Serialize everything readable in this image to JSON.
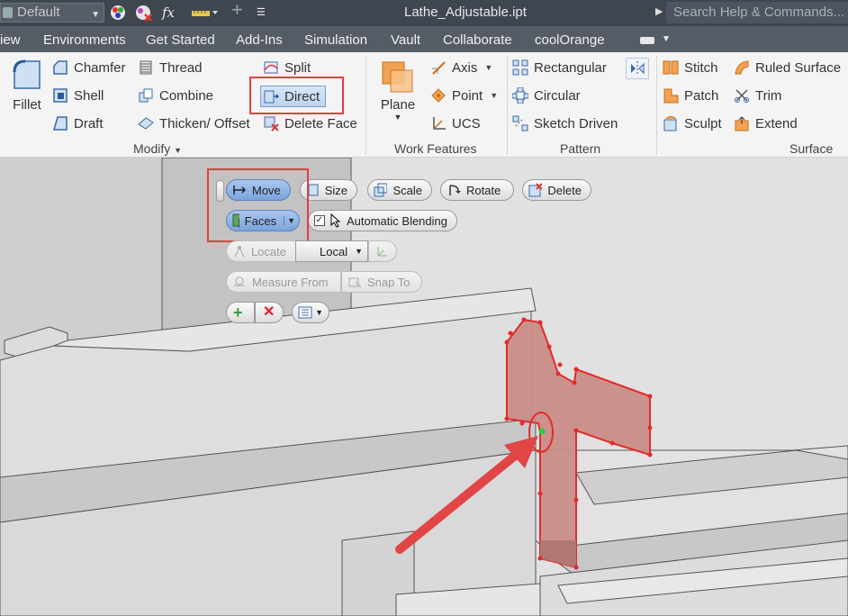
{
  "titlebar": {
    "style_combo": "Default",
    "document_title": "Lathe_Adjustable.ipt",
    "help_search_placeholder": "Search Help & Commands..."
  },
  "tabs": [
    "iew",
    "Environments",
    "Get Started",
    "Add-Ins",
    "Simulation",
    "Vault",
    "Collaborate",
    "coolOrange"
  ],
  "ribbon": {
    "modify": {
      "fillet": "Fillet",
      "chamfer": "Chamfer",
      "shell": "Shell",
      "draft": "Draft",
      "thread": "Thread",
      "combine": "Combine",
      "thicken_offset": "Thicken/ Offset",
      "split": "Split",
      "direct": "Direct",
      "delete_face": "Delete Face",
      "group_label": "Modify"
    },
    "work_features": {
      "plane": "Plane",
      "axis": "Axis",
      "point": "Point",
      "ucs": "UCS",
      "group_label": "Work Features"
    },
    "pattern": {
      "rectangular": "Rectangular",
      "circular": "Circular",
      "sketch_driven": "Sketch Driven",
      "group_label": "Pattern"
    },
    "surface": {
      "stitch": "Stitch",
      "patch": "Patch",
      "sculpt": "Sculpt",
      "ruled_surface": "Ruled Surface",
      "trim": "Trim",
      "extend": "Extend",
      "group_label": "Surface"
    }
  },
  "minitoolbar": {
    "move": "Move",
    "size": "Size",
    "scale": "Scale",
    "rotate": "Rotate",
    "delete": "Delete",
    "faces": "Faces",
    "automatic_blending": "Automatic Blending",
    "automatic_blending_checked": true,
    "locate": "Locate",
    "coordinate_system": "Local",
    "measure_from": "Measure From",
    "snap_to": "Snap To"
  },
  "colors": {
    "highlight_red": "#e0403c",
    "selection_fill": "#c98d88",
    "active_button": "#7ba3dc"
  }
}
